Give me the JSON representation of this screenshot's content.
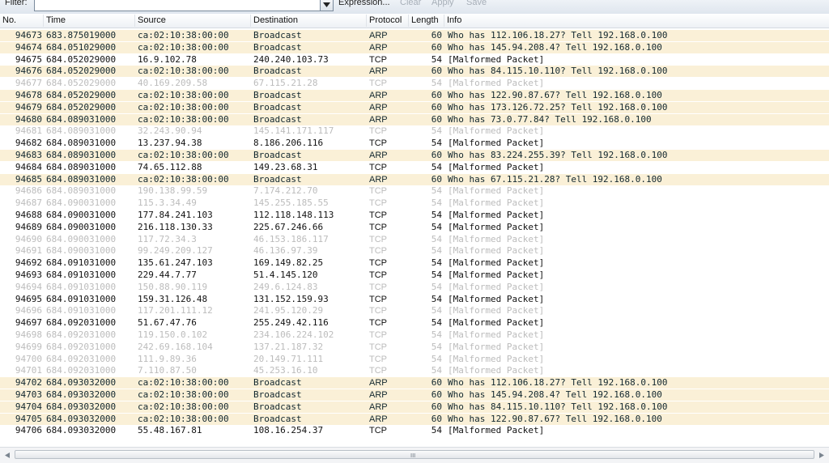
{
  "toolbar": {
    "filter_label": "Filter:",
    "filter_value": "",
    "expression_label": "Expression...",
    "clear_label": "Clear",
    "apply_label": "Apply",
    "save_label": "Save"
  },
  "columns": {
    "no": "No.",
    "time": "Time",
    "source": "Source",
    "destination": "Destination",
    "protocol": "Protocol",
    "length": "Length",
    "info": "Info"
  },
  "colors": {
    "arp_row_bg": "#faf0d7",
    "tcp_row_bg": "#ffffff",
    "malformed_dim_text": "#bcbcbc"
  },
  "packets": [
    {
      "no": "94673",
      "time": "683.875019000",
      "source": "ca:02:10:38:00:00",
      "destination": "Broadcast",
      "protocol": "ARP",
      "length": "60",
      "info": "Who has 112.106.18.27?  Tell 192.168.0.100",
      "style": "arp"
    },
    {
      "no": "94674",
      "time": "684.051029000",
      "source": "ca:02:10:38:00:00",
      "destination": "Broadcast",
      "protocol": "ARP",
      "length": "60",
      "info": "Who has 145.94.208.4?  Tell 192.168.0.100",
      "style": "arp"
    },
    {
      "no": "94675",
      "time": "684.052029000",
      "source": "16.9.102.78",
      "destination": "240.240.103.73",
      "protocol": "TCP",
      "length": "54",
      "info": "[Malformed Packet]",
      "style": "tcp"
    },
    {
      "no": "94676",
      "time": "684.052029000",
      "source": "ca:02:10:38:00:00",
      "destination": "Broadcast",
      "protocol": "ARP",
      "length": "60",
      "info": "Who has 84.115.10.110?  Tell 192.168.0.100",
      "style": "arp"
    },
    {
      "no": "94677",
      "time": "684.052029000",
      "source": "40.169.209.58",
      "destination": "67.115.21.28",
      "protocol": "TCP",
      "length": "54",
      "info": "[Malformed Packet]",
      "style": "dim"
    },
    {
      "no": "94678",
      "time": "684.052029000",
      "source": "ca:02:10:38:00:00",
      "destination": "Broadcast",
      "protocol": "ARP",
      "length": "60",
      "info": "Who has 122.90.87.67?  Tell 192.168.0.100",
      "style": "arp"
    },
    {
      "no": "94679",
      "time": "684.052029000",
      "source": "ca:02:10:38:00:00",
      "destination": "Broadcast",
      "protocol": "ARP",
      "length": "60",
      "info": "Who has 173.126.72.25?  Tell 192.168.0.100",
      "style": "arp"
    },
    {
      "no": "94680",
      "time": "684.089031000",
      "source": "ca:02:10:38:00:00",
      "destination": "Broadcast",
      "protocol": "ARP",
      "length": "60",
      "info": "Who has 73.0.77.84?  Tell 192.168.0.100",
      "style": "arp"
    },
    {
      "no": "94681",
      "time": "684.089031000",
      "source": "32.243.90.94",
      "destination": "145.141.171.117",
      "protocol": "TCP",
      "length": "54",
      "info": "[Malformed Packet]",
      "style": "dim"
    },
    {
      "no": "94682",
      "time": "684.089031000",
      "source": "13.237.94.38",
      "destination": "8.186.206.116",
      "protocol": "TCP",
      "length": "54",
      "info": "[Malformed Packet]",
      "style": "tcp"
    },
    {
      "no": "94683",
      "time": "684.089031000",
      "source": "ca:02:10:38:00:00",
      "destination": "Broadcast",
      "protocol": "ARP",
      "length": "60",
      "info": "Who has 83.224.255.39?  Tell 192.168.0.100",
      "style": "arp"
    },
    {
      "no": "94684",
      "time": "684.089031000",
      "source": "74.65.112.88",
      "destination": "149.23.68.31",
      "protocol": "TCP",
      "length": "54",
      "info": "[Malformed Packet]",
      "style": "tcp"
    },
    {
      "no": "94685",
      "time": "684.089031000",
      "source": "ca:02:10:38:00:00",
      "destination": "Broadcast",
      "protocol": "ARP",
      "length": "60",
      "info": "Who has 67.115.21.28?  Tell 192.168.0.100",
      "style": "arp"
    },
    {
      "no": "94686",
      "time": "684.089031000",
      "source": "190.138.99.59",
      "destination": "7.174.212.70",
      "protocol": "TCP",
      "length": "54",
      "info": "[Malformed Packet]",
      "style": "dim"
    },
    {
      "no": "94687",
      "time": "684.090031000",
      "source": "115.3.34.49",
      "destination": "145.255.185.55",
      "protocol": "TCP",
      "length": "54",
      "info": "[Malformed Packet]",
      "style": "dim"
    },
    {
      "no": "94688",
      "time": "684.090031000",
      "source": "177.84.241.103",
      "destination": "112.118.148.113",
      "protocol": "TCP",
      "length": "54",
      "info": "[Malformed Packet]",
      "style": "tcp"
    },
    {
      "no": "94689",
      "time": "684.090031000",
      "source": "216.118.130.33",
      "destination": "225.67.246.66",
      "protocol": "TCP",
      "length": "54",
      "info": "[Malformed Packet]",
      "style": "tcp"
    },
    {
      "no": "94690",
      "time": "684.090031000",
      "source": "117.72.34.3",
      "destination": "46.153.186.117",
      "protocol": "TCP",
      "length": "54",
      "info": "[Malformed Packet]",
      "style": "dim"
    },
    {
      "no": "94691",
      "time": "684.090031000",
      "source": "99.249.209.127",
      "destination": "46.136.97.39",
      "protocol": "TCP",
      "length": "54",
      "info": "[Malformed Packet]",
      "style": "dim"
    },
    {
      "no": "94692",
      "time": "684.091031000",
      "source": "135.61.247.103",
      "destination": "169.149.82.25",
      "protocol": "TCP",
      "length": "54",
      "info": "[Malformed Packet]",
      "style": "tcp"
    },
    {
      "no": "94693",
      "time": "684.091031000",
      "source": "229.44.7.77",
      "destination": "51.4.145.120",
      "protocol": "TCP",
      "length": "54",
      "info": "[Malformed Packet]",
      "style": "tcp"
    },
    {
      "no": "94694",
      "time": "684.091031000",
      "source": "150.88.90.119",
      "destination": "249.6.124.83",
      "protocol": "TCP",
      "length": "54",
      "info": "[Malformed Packet]",
      "style": "dim"
    },
    {
      "no": "94695",
      "time": "684.091031000",
      "source": "159.31.126.48",
      "destination": "131.152.159.93",
      "protocol": "TCP",
      "length": "54",
      "info": "[Malformed Packet]",
      "style": "tcp"
    },
    {
      "no": "94696",
      "time": "684.091031000",
      "source": "117.201.111.12",
      "destination": "241.95.120.29",
      "protocol": "TCP",
      "length": "54",
      "info": "[Malformed Packet]",
      "style": "dim"
    },
    {
      "no": "94697",
      "time": "684.092031000",
      "source": "51.67.47.76",
      "destination": "255.249.42.116",
      "protocol": "TCP",
      "length": "54",
      "info": "[Malformed Packet]",
      "style": "tcp"
    },
    {
      "no": "94698",
      "time": "684.092031000",
      "source": "119.150.0.102",
      "destination": "234.106.224.102",
      "protocol": "TCP",
      "length": "54",
      "info": "[Malformed Packet]",
      "style": "dim"
    },
    {
      "no": "94699",
      "time": "684.092031000",
      "source": "242.69.168.104",
      "destination": "137.21.187.32",
      "protocol": "TCP",
      "length": "54",
      "info": "[Malformed Packet]",
      "style": "dim"
    },
    {
      "no": "94700",
      "time": "684.092031000",
      "source": "111.9.89.36",
      "destination": "20.149.71.111",
      "protocol": "TCP",
      "length": "54",
      "info": "[Malformed Packet]",
      "style": "dim"
    },
    {
      "no": "94701",
      "time": "684.092031000",
      "source": "7.110.87.50",
      "destination": "45.253.16.10",
      "protocol": "TCP",
      "length": "54",
      "info": "[Malformed Packet]",
      "style": "dim"
    },
    {
      "no": "94702",
      "time": "684.093032000",
      "source": "ca:02:10:38:00:00",
      "destination": "Broadcast",
      "protocol": "ARP",
      "length": "60",
      "info": "Who has 112.106.18.27?  Tell 192.168.0.100",
      "style": "arp"
    },
    {
      "no": "94703",
      "time": "684.093032000",
      "source": "ca:02:10:38:00:00",
      "destination": "Broadcast",
      "protocol": "ARP",
      "length": "60",
      "info": "Who has 145.94.208.4?  Tell 192.168.0.100",
      "style": "arp"
    },
    {
      "no": "94704",
      "time": "684.093032000",
      "source": "ca:02:10:38:00:00",
      "destination": "Broadcast",
      "protocol": "ARP",
      "length": "60",
      "info": "Who has 84.115.10.110?  Tell 192.168.0.100",
      "style": "arp"
    },
    {
      "no": "94705",
      "time": "684.093032000",
      "source": "ca:02:10:38:00:00",
      "destination": "Broadcast",
      "protocol": "ARP",
      "length": "60",
      "info": "Who has 122.90.87.67?  Tell 192.168.0.100",
      "style": "arp"
    },
    {
      "no": "94706",
      "time": "684.093032000",
      "source": "55.48.167.81",
      "destination": "108.16.254.37",
      "protocol": "TCP",
      "length": "54",
      "info": "[Malformed Packet]",
      "style": "tcp"
    }
  ],
  "scrollbar": {
    "grip": "III"
  }
}
